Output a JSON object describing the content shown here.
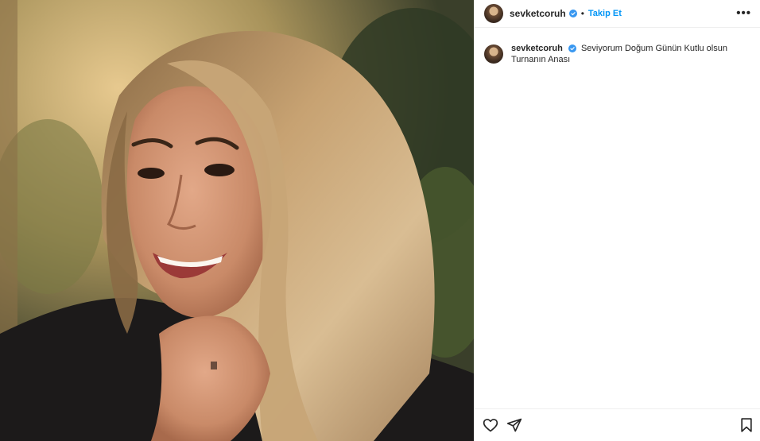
{
  "post": {
    "header": {
      "username": "sevketcoruh",
      "separator": "•",
      "follow_label": "Takip Et",
      "more_label": "•••"
    },
    "caption": {
      "username": "sevketcoruh",
      "text": "Seviyorum Doğum Günün Kutlu olsun Turnanın Anası"
    },
    "icons": {
      "like": "heart-icon",
      "share": "send-icon",
      "save": "bookmark-icon",
      "verified": "verified-badge-icon"
    },
    "colors": {
      "follow": "#0095f6",
      "verified": "#3897f0",
      "text": "#262626",
      "divider": "#efefef"
    }
  }
}
